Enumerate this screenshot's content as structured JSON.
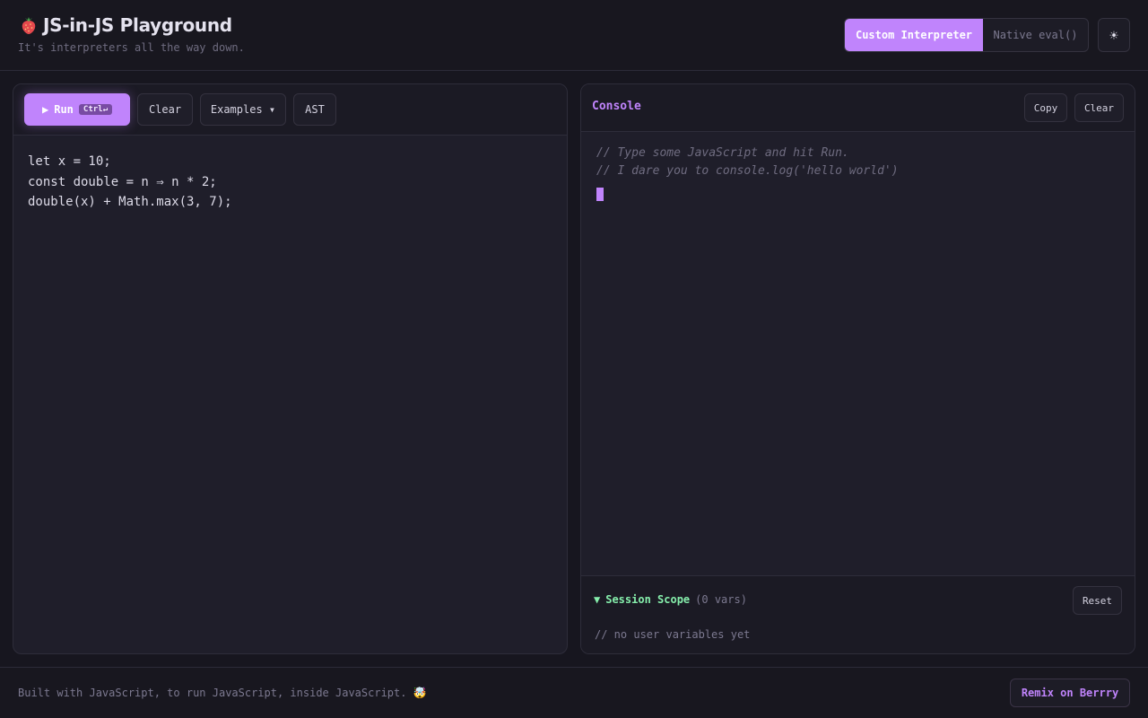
{
  "header": {
    "title": "JS-in-JS Playground",
    "subtitle": "It's interpreters all the way down.",
    "logo_icon": "strawberry-icon",
    "mode_toggle": {
      "active": "Custom Interpreter",
      "inactive": "Native eval()"
    },
    "theme_icon": "☀"
  },
  "editor": {
    "toolbar": {
      "run_label": "Run",
      "run_shortcut": "Ctrl↵",
      "clear_label": "Clear",
      "examples_label": "Examples ▾",
      "ast_label": "AST"
    },
    "code": "let x = 10;\nconst double = n ⇒ n * 2;\ndouble(x) + Math.max(3, 7);"
  },
  "console": {
    "title": "Console",
    "copy_label": "Copy",
    "clear_label": "Clear",
    "lines": [
      "// Type some JavaScript and hit Run.",
      "// I dare you to console.log('hello world')"
    ]
  },
  "scope": {
    "toggle": "▼",
    "title": "Session Scope",
    "count": "(0 vars)",
    "reset_label": "Reset",
    "empty_text": "// no user variables yet"
  },
  "footer": {
    "text": "Built with JavaScript, to run JavaScript, inside JavaScript. 🤯",
    "remix_label": "Remix on Berrry"
  },
  "colors": {
    "accent": "#c084fc",
    "scope_green": "#86efac",
    "background": "#17161f"
  }
}
